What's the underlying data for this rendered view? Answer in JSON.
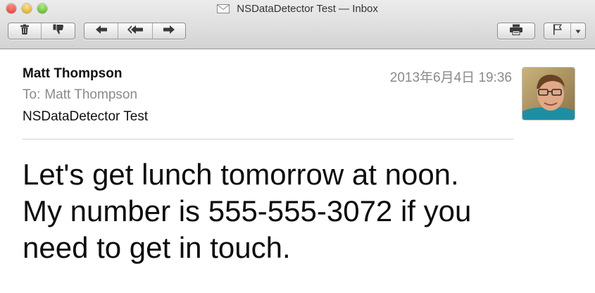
{
  "window": {
    "title": "NSDataDetector Test — Inbox"
  },
  "toolbar": {
    "delete_icon": "trash-icon",
    "junk_icon": "thumbs-down-icon",
    "reply_icon": "reply-arrow-icon",
    "reply_all_icon": "reply-all-arrow-icon",
    "forward_icon": "forward-arrow-icon",
    "print_icon": "printer-icon",
    "flag_icon": "flag-icon"
  },
  "message": {
    "from": "Matt Thompson",
    "to_label": "To:",
    "to": "Matt Thompson",
    "subject": "NSDataDetector Test",
    "date": "2013年6月4日 19:36",
    "body_lines": [
      "Let's get lunch tomorrow at noon.",
      "My number is 555-555-3072 if you",
      "need to get in touch."
    ]
  }
}
